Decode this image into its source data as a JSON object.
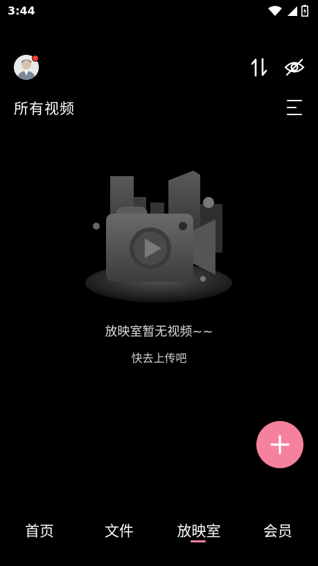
{
  "status_bar": {
    "time": "3:44",
    "icons": [
      "wifi-icon",
      "signal-icon",
      "battery-icon"
    ]
  },
  "header": {
    "has_notification_dot": true,
    "actions": [
      "sort-icon",
      "eye-off-icon"
    ]
  },
  "section": {
    "title": "所有视频",
    "menu_icon": "menu-icon"
  },
  "empty_state": {
    "title": "放映室暂无视频~~",
    "subtitle": "快去上传吧"
  },
  "fab": {
    "icon": "plus-icon",
    "color": "#f6819f"
  },
  "bottom_nav": {
    "items": [
      {
        "label": "首页"
      },
      {
        "label": "文件"
      },
      {
        "label": "放映室"
      },
      {
        "label": "会员"
      }
    ],
    "active_index": 2,
    "accent": "#f6819f"
  }
}
